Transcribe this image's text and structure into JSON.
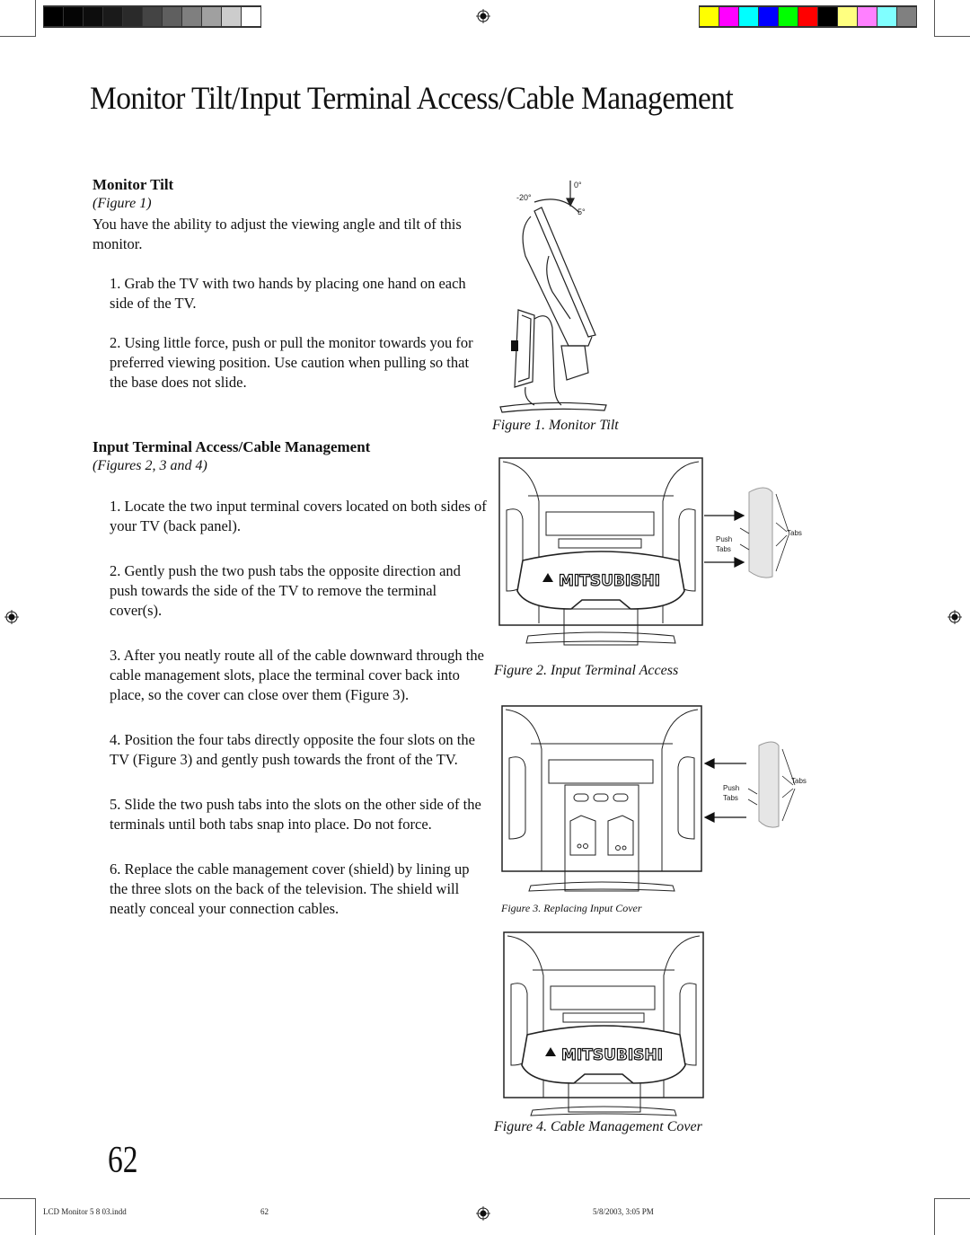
{
  "printer_marks": {
    "grayscale_swatches": [
      "#000000",
      "#050505",
      "#0d0d0d",
      "#1a1a1a",
      "#2a2a2a",
      "#444444",
      "#5f5f5f",
      "#7f7f7f",
      "#a0a0a0",
      "#cccccc",
      "#ffffff"
    ],
    "color_swatches": [
      "#ffff00",
      "#ff00ff",
      "#00ffff",
      "#0000ff",
      "#00ff00",
      "#ff0000",
      "#000000",
      "#ffff80",
      "#ff80ff",
      "#80ffff",
      "#808080"
    ]
  },
  "page": {
    "title": "Monitor Tilt/Input Terminal Access/Cable Management",
    "number": "62"
  },
  "monitor_tilt": {
    "heading": "Monitor Tilt",
    "figure_ref": "(Figure 1)",
    "intro": "You have the ability to adjust the viewing angle and tilt of this monitor.",
    "steps": [
      "1.  Grab the TV with two hands by placing one hand on each side of the TV.",
      "2.  Using little force, push or pull the monitor towards you for preferred viewing position.  Use caution when pulling so that the base does not slide."
    ]
  },
  "input_terminal": {
    "heading": "Input Terminal Access/Cable Management",
    "figure_ref": "(Figures 2, 3 and 4)",
    "steps": [
      "1.  Locate the two input terminal covers located on both sides of your TV (back panel).",
      "2.  Gently push the two push tabs the opposite direction and push towards the side of the TV to remove the terminal cover(s).",
      "3.  After you neatly route all of the cable downward through the cable management slots, place the terminal cover back into place, so the cover can close over them (Figure 3).",
      "4.  Position the four tabs directly opposite the four slots on the TV (Figure 3) and gently push towards the front of the TV.",
      "5.  Slide the two push tabs into the slots on the other side of the terminals until both tabs snap into place.  Do not force.",
      "6.  Replace the cable management cover (shield) by lining up the three slots on the back of the television. The shield will neatly conceal your connection cables."
    ]
  },
  "figures": {
    "fig1": {
      "caption": "Figure 1. Monitor Tilt",
      "angle_labels": [
        "0°",
        "-20°",
        "5°"
      ]
    },
    "fig2": {
      "caption": "Figure 2.  Input Terminal Access",
      "brand": "MITSUBISHI",
      "label_push_tabs": [
        "Push",
        "Tabs"
      ],
      "label_tabs": "Tabs"
    },
    "fig3": {
      "caption": "Figure 3.  Replacing Input Cover",
      "label_push_tabs": [
        "Push",
        "Tabs"
      ],
      "label_tabs": "Tabs"
    },
    "fig4": {
      "caption": "Figure 4.  Cable Management Cover",
      "brand": "MITSUBISHI"
    }
  },
  "slug": {
    "filename": "LCD Monitor 5 8 03.indd",
    "page": "62",
    "datetime": "5/8/2003, 3:05 PM"
  }
}
